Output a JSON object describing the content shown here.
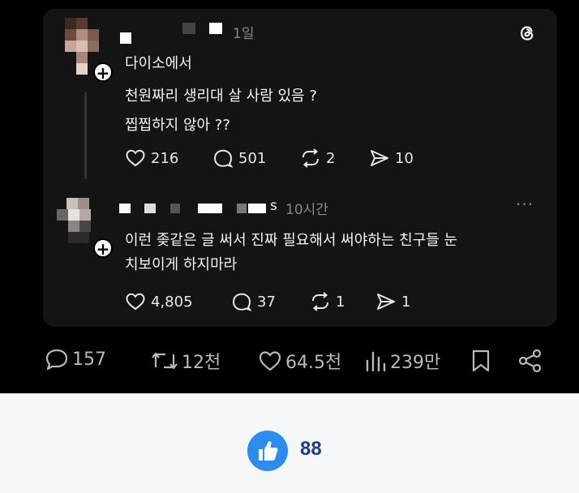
{
  "post": {
    "time": "1일",
    "lines": [
      "다이소에서",
      "천원짜리 생리대 살 사람 있음 ?",
      "찝찝하지 않아 ??"
    ],
    "likes": "216",
    "replies": "501",
    "reposts": "2",
    "shares": "10",
    "app_icon": "threads-icon"
  },
  "reply": {
    "username_tail": "s",
    "time": "10시간",
    "more": "···",
    "lines": [
      "이런 좆같은 글 써서 진짜 필요해서 써야하는 친구들 눈",
      "치보이게 하지마라"
    ],
    "likes": "4,805",
    "replies": "37",
    "reposts": "1",
    "shares": "1"
  },
  "bottom_bar": {
    "comments": "157",
    "retweets": "12천",
    "likes": "64.5천",
    "views": "239만"
  },
  "footer": {
    "like_count": "88",
    "accent": "#2d8cf0"
  }
}
